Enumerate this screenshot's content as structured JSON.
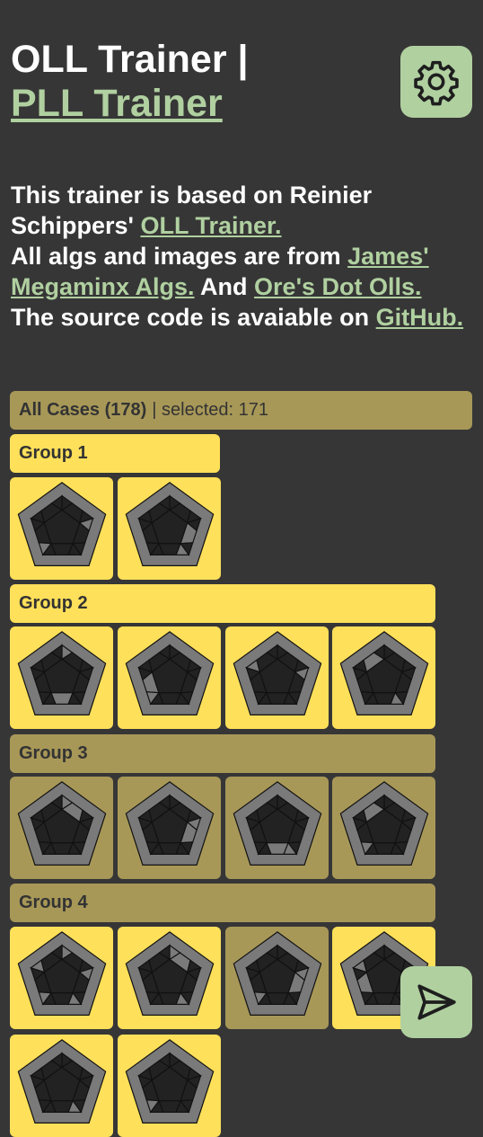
{
  "header": {
    "title_prefix": "OLL Trainer |",
    "title_link": "PLL Trainer"
  },
  "intro": {
    "line1": "This trainer is based on Reinier Schippers'",
    "link1": "OLL Trainer.",
    "line2": "All algs and images are from",
    "link2": "James' Megaminx Algs.",
    "line3": "And",
    "link3": "Ore's Dot Olls.",
    "line4": "The source code is avaiable on",
    "link4": "GitHub."
  },
  "summary": {
    "all_cases": "All Cases (178)",
    "selected": "| selected: 171"
  },
  "groups": [
    {
      "label": "Group 1"
    },
    {
      "label": "Group 2"
    },
    {
      "label": "Group 3"
    },
    {
      "label": "Group 4"
    }
  ],
  "colors": {
    "background": "#363636",
    "accent_green": "#b0d0a0",
    "selected_yellow": "#ffe05a",
    "unselected_khaki": "#a89858"
  },
  "icons": {
    "settings": "gear-icon",
    "send": "send-icon"
  }
}
